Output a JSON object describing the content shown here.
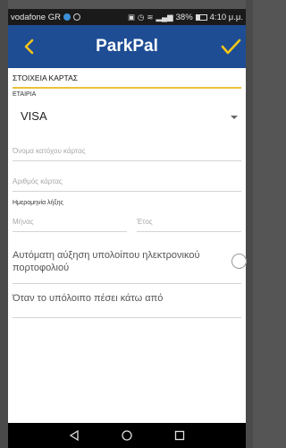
{
  "status_bar": {
    "carrier": "vodafone GR",
    "battery_percent_text": "38%",
    "battery_level": 0.38,
    "time": "4:10 μ.μ."
  },
  "header": {
    "title": "ParkPal",
    "back_icon": "chevron-left-icon",
    "confirm_icon": "check-icon",
    "accent_color": "#f5c518",
    "background_color": "#1e4d94"
  },
  "form": {
    "section_title": "ΣΤΟΙΧΕΙΑ ΚΑΡΤΑΣ",
    "company_label": "ΕΤΑΙΡΙΑ",
    "company_value": "VISA",
    "cardholder_placeholder": "Όνομα κατόχου κάρτας",
    "card_number_placeholder": "Αριθμός κάρτας",
    "expiry_label": "Ημερομηνία λήξης",
    "month_placeholder": "Μήνας",
    "year_placeholder": "Έτος",
    "auto_topup_label": "Αυτόματη αύξηση υπολοίπου ηλεκτρονικού πορτοφολιού",
    "threshold_label": "Όταν το υπόλοιπο πέσει κάτω από"
  },
  "nav": {
    "back_icon": "triangle-back-icon",
    "home_icon": "circle-home-icon",
    "recents_icon": "square-recents-icon"
  }
}
